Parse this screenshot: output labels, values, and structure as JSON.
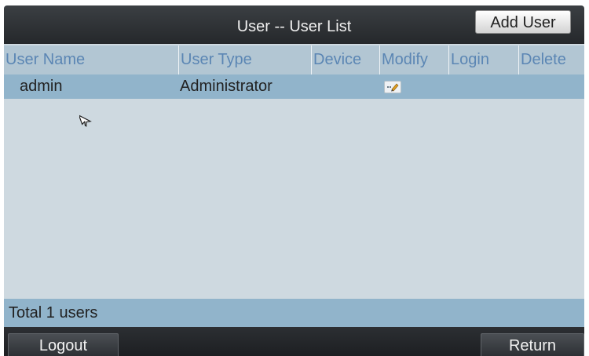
{
  "window": {
    "title": "User -- User List",
    "add_user_label": "Add User"
  },
  "table": {
    "columns": [
      "User Name",
      "User Type",
      "Device",
      "Modify",
      "Login",
      "Delete"
    ],
    "rows": [
      {
        "user_name": "admin",
        "user_type": "Administrator",
        "modify_icon": "edit-icon"
      }
    ]
  },
  "footer": {
    "total_text": "Total 1 users"
  },
  "bottom_bar": {
    "logout_label": "Logout",
    "return_label": "Return"
  },
  "colors": {
    "title_bar": "#2f3236",
    "header_text": "#5b86b4",
    "row_highlight": "#91b4cb",
    "body_bg": "#ced9e0"
  }
}
